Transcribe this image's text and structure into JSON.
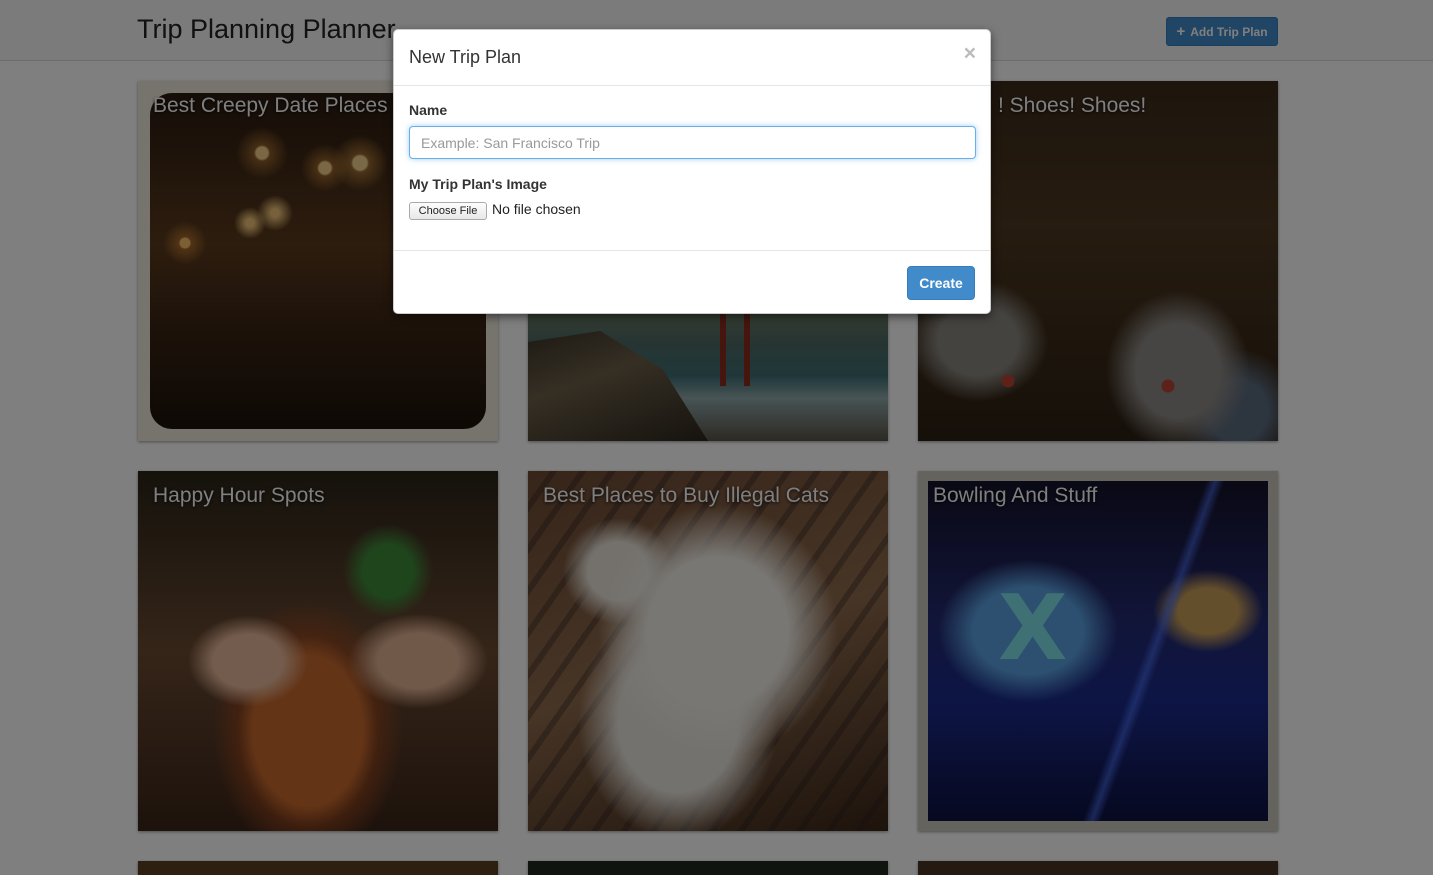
{
  "navbar": {
    "brand": "Trip Planning Planner",
    "add_button_icon": "plus-icon",
    "add_button_label": "Add Trip Plan"
  },
  "trips": [
    {
      "title": "Best Creepy Date Places Francisco"
    },
    {
      "title": ""
    },
    {
      "title": "! Shoes! Shoes!"
    },
    {
      "title": "Happy Hour Spots"
    },
    {
      "title": "Best Places to Buy Illegal Cats"
    },
    {
      "title": "Bowling And Stuff"
    }
  ],
  "modal": {
    "title": "New Trip Plan",
    "close_glyph": "×",
    "name_label": "Name",
    "name_placeholder": "Example: San Francisco Trip",
    "name_value": "",
    "image_label": "My Trip Plan's Image",
    "choose_file_label": "Choose File",
    "file_status": "No file chosen",
    "create_label": "Create"
  },
  "colors": {
    "primary": "#428bca",
    "input_focus": "#66afe9"
  }
}
